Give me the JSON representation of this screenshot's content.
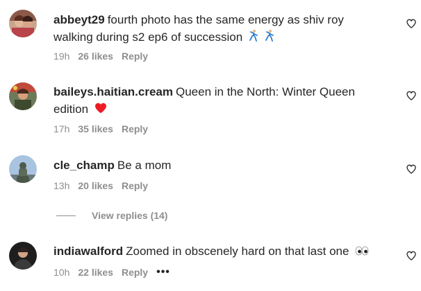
{
  "comments": [
    {
      "username": "abbeyt29",
      "text": "fourth photo has the same energy as shiv roy walking during s2 ep6 of succession",
      "emoji": "dancer-emoji x2",
      "time": "19h",
      "likes": "26 likes",
      "reply": "Reply"
    },
    {
      "username": "baileys.haitian.cream",
      "text": "Queen in the North: Winter Queen edition",
      "emoji": "red-heart-emoji",
      "time": "17h",
      "likes": "35 likes",
      "reply": "Reply"
    },
    {
      "username": "cle_champ",
      "text": "Be a mom",
      "time": "13h",
      "likes": "20 likes",
      "reply": "Reply"
    },
    {
      "username": "indiawalford",
      "text": "Zoomed in obscenely hard on that last one",
      "emoji": "eyes-emoji",
      "time": "10h",
      "likes": "22 likes",
      "reply": "Reply",
      "more": "•••"
    }
  ],
  "view_replies": "View replies (14)",
  "colors": {
    "text": "#262626",
    "meta": "#8e8e8e",
    "heart_red": "#ed1c24"
  }
}
